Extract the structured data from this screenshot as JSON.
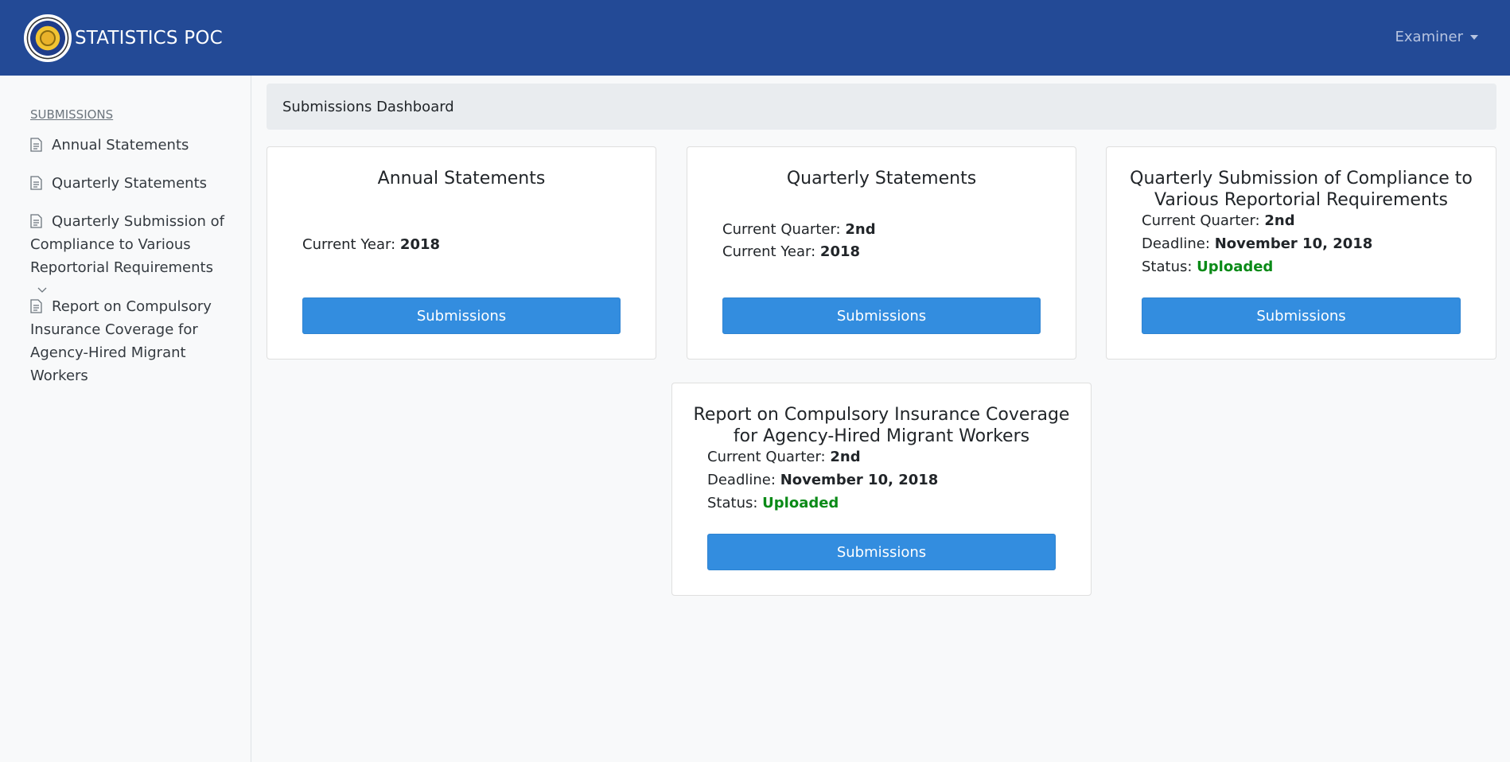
{
  "header": {
    "brand": "STATISTICS POC",
    "user_menu": "Examiner"
  },
  "sidebar": {
    "heading": "SUBMISSIONS",
    "items": [
      {
        "label": "Annual Statements"
      },
      {
        "label": "Quarterly Statements"
      },
      {
        "label": "Quarterly Submission of Compliance to Various Reportorial Requirements"
      },
      {
        "label": "Report on Compulsory Insurance Coverage for Agency-Hired Migrant Workers"
      }
    ]
  },
  "breadcrumb": "Submissions Dashboard",
  "cards": [
    {
      "title": "Annual Statements",
      "year_label": "Current Year:",
      "year_value": "2018",
      "button": "Submissions"
    },
    {
      "title": "Quarterly Statements",
      "quarter_label": "Current Quarter:",
      "quarter_value": "2nd",
      "year_label": "Current Year:",
      "year_value": "2018",
      "button": "Submissions"
    },
    {
      "title": "Quarterly Submission of Compliance to Various Reportorial Requirements",
      "quarter_label": "Current Quarter:",
      "quarter_value": "2nd",
      "deadline_label": "Deadline:",
      "deadline_value": "November 10, 2018",
      "status_label": "Status:",
      "status_value": "Uploaded",
      "button": "Submissions"
    },
    {
      "title": "Report on Compulsory Insurance Coverage for Agency-Hired Migrant Workers",
      "quarter_label": "Current Quarter:",
      "quarter_value": "2nd",
      "deadline_label": "Deadline:",
      "deadline_value": "November 10, 2018",
      "status_label": "Status:",
      "status_value": "Uploaded",
      "button": "Submissions"
    }
  ],
  "colors": {
    "navbar": "#234a96",
    "button": "#338ddf",
    "status_uploaded": "#0a8a17"
  }
}
